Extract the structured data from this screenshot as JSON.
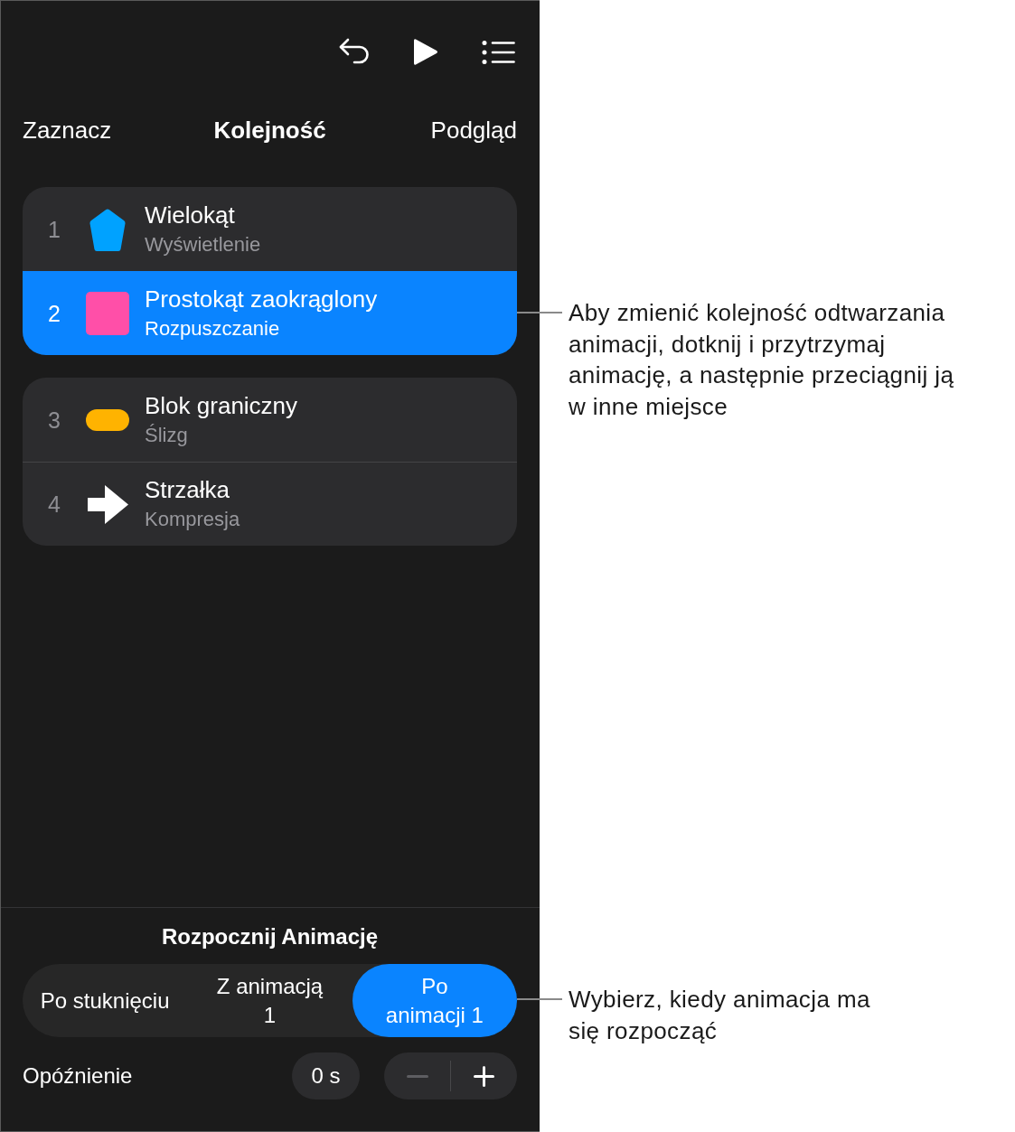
{
  "navigation": {
    "left_button": "Zaznacz",
    "title": "Kolejność",
    "right_button": "Podgląd"
  },
  "animation_groups": [
    {
      "items": [
        {
          "number": "1",
          "kind": "pentagon",
          "color": "#00a2ff",
          "name": "Wielokąt",
          "effect": "Wyświetlenie",
          "selected": false
        },
        {
          "number": "2",
          "kind": "square",
          "color": "#ff4fa8",
          "name": "Prostokąt zaokrąglony",
          "effect": "Rozpuszczanie",
          "selected": true
        }
      ]
    },
    {
      "items": [
        {
          "number": "3",
          "kind": "pill",
          "color": "#ffb300",
          "name": "Blok graniczny",
          "effect": "Ślizg",
          "selected": false
        },
        {
          "number": "4",
          "kind": "arrow",
          "color": "#ffffff",
          "name": "Strzałka",
          "effect": "Kompresja",
          "selected": false
        }
      ]
    }
  ],
  "start_animation": {
    "title": "Rozpocznij Animację",
    "options": [
      {
        "label": "Po stuknięciu",
        "selected": false
      },
      {
        "label": "Z animacją 1",
        "selected": false
      },
      {
        "label": "Po animacji 1",
        "selected": true
      }
    ]
  },
  "delay": {
    "label": "Opóźnienie",
    "value": "0 s",
    "stepper": [
      {
        "kind": "decrement",
        "disabled": true
      },
      {
        "kind": "increment",
        "disabled": false
      }
    ]
  },
  "callouts": [
    {
      "text": "Aby zmienić kolejność odtwarzania animacji, dotknij i przytrzymaj animację, a następnie przeciągnij ją w inne miejsce"
    },
    {
      "text": "Wybierz, kiedy animacja ma się rozpocząć"
    }
  ]
}
